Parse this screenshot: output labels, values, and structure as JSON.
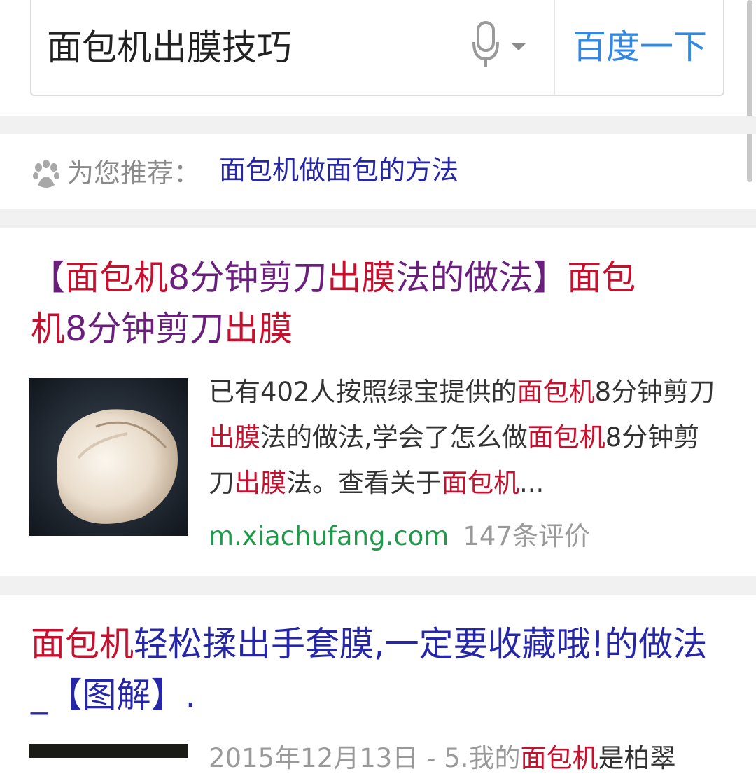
{
  "search": {
    "query": "面包机出膜技巧",
    "button_label": "百度一下"
  },
  "recommend": {
    "label": "为您推荐：",
    "link": "面包机做面包的方法"
  },
  "results": [
    {
      "title_segments": [
        {
          "text": "【",
          "style": "p"
        },
        {
          "text": "面包机",
          "style": "k"
        },
        {
          "text": "8分钟剪刀",
          "style": "p"
        },
        {
          "text": "出膜",
          "style": "k"
        },
        {
          "text": "法的做法】",
          "style": "p"
        },
        {
          "text": "面包",
          "style": "k"
        }
      ],
      "title_segments_line2": [
        {
          "text": "机",
          "style": "k"
        },
        {
          "text": "8分钟剪刀",
          "style": "p"
        },
        {
          "text": "出膜",
          "style": "k"
        }
      ],
      "snippet_segments": [
        {
          "text": "已有402人按照绿宝提供的",
          "style": ""
        },
        {
          "text": "面包机",
          "style": "k"
        },
        {
          "text": "8分钟剪刀",
          "style": ""
        },
        {
          "text": "出膜",
          "style": "k"
        },
        {
          "text": "法的做法,学会了怎么做",
          "style": ""
        },
        {
          "text": "面包机",
          "style": "k"
        },
        {
          "text": "8分钟剪刀",
          "style": ""
        },
        {
          "text": "出膜",
          "style": "k"
        },
        {
          "text": "法。查看关于",
          "style": ""
        },
        {
          "text": "面包机",
          "style": "k"
        },
        {
          "text": "...",
          "style": ""
        }
      ],
      "url": "m.xiachufang.com",
      "review_count": "147条评价"
    },
    {
      "title_segments": [
        {
          "text": "面包机",
          "style": "k"
        },
        {
          "text": "轻松揉出手套膜,一定要收藏哦!的做法_【图解】.",
          "style": ""
        }
      ],
      "snippet_segments": [
        {
          "text": "2015年12月13日 - 5.我的",
          "style": ""
        },
        {
          "text": "面包机",
          "style": "k"
        },
        {
          "text": "是柏翠",
          "style": ""
        }
      ]
    }
  ]
}
